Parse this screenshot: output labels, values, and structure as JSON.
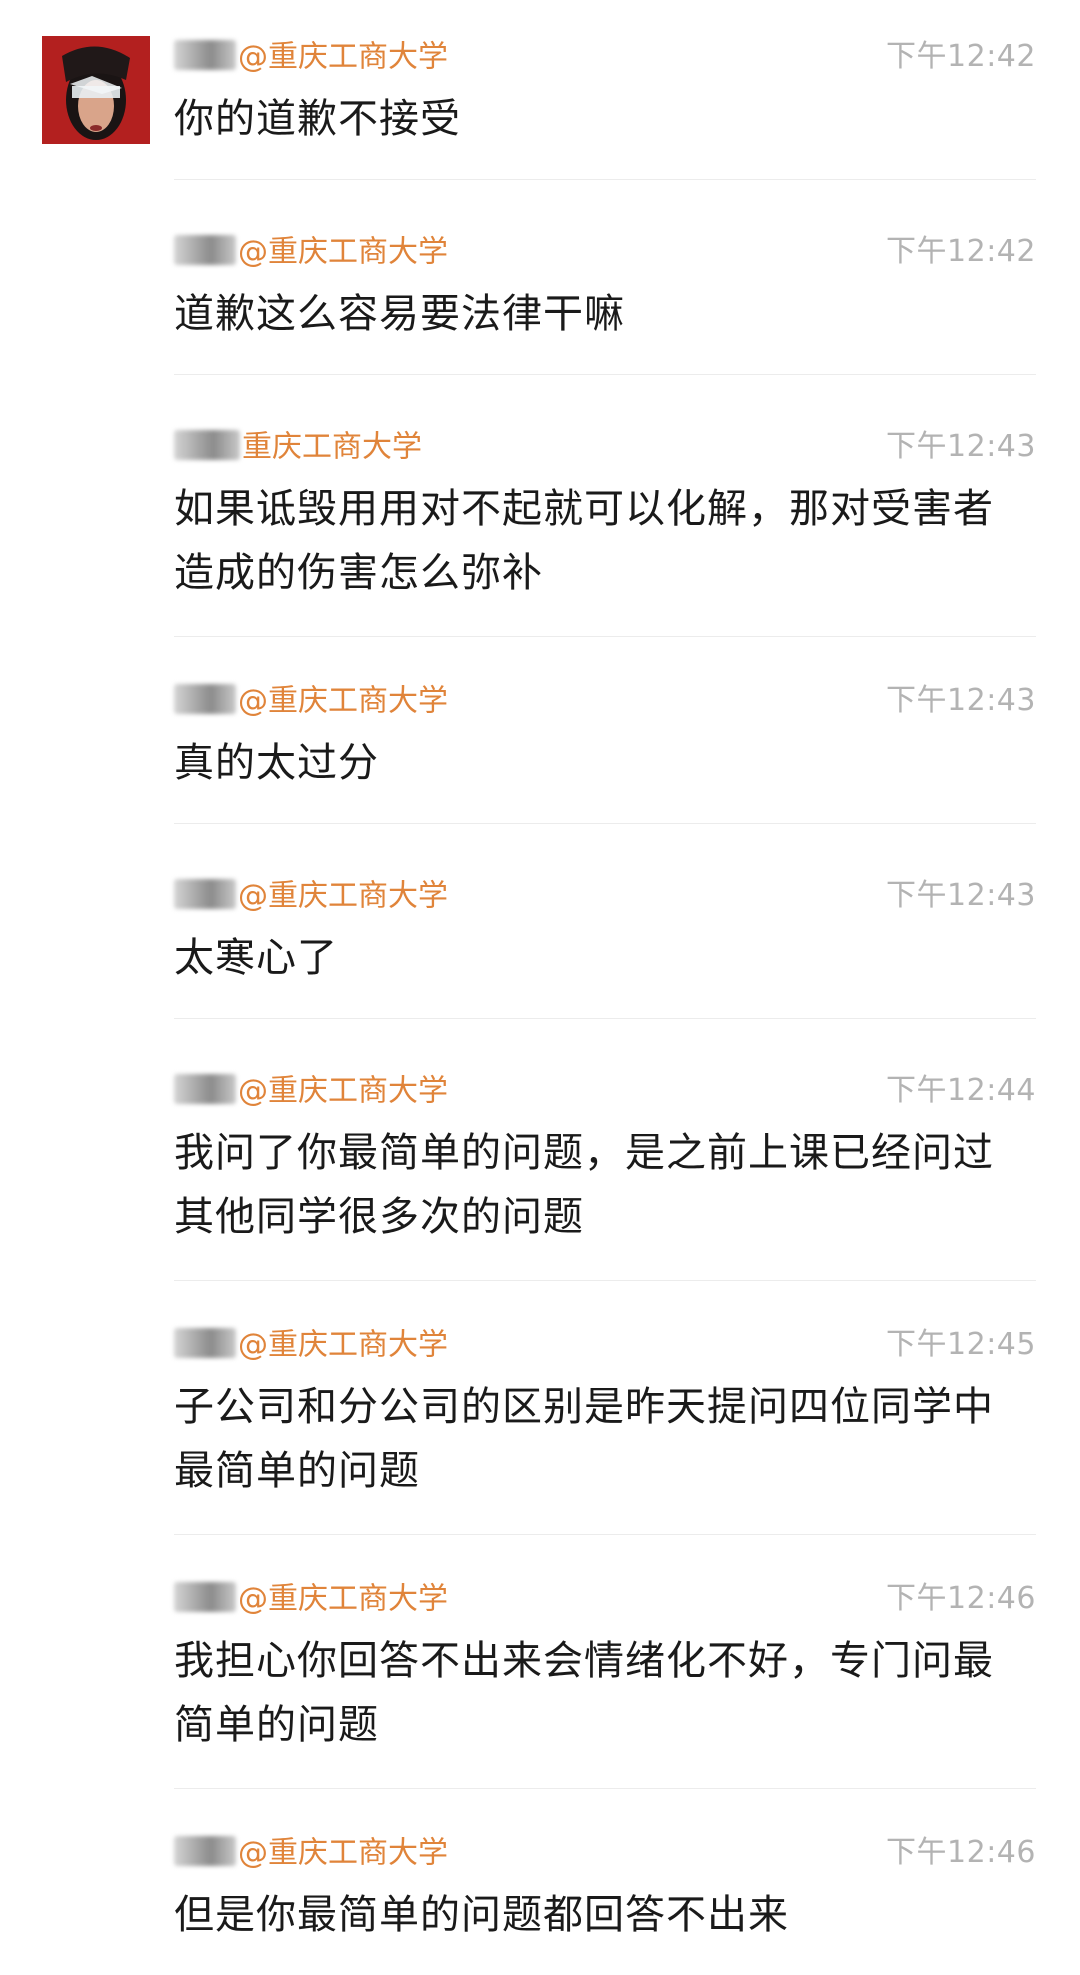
{
  "comments": [
    {
      "school": "@重庆工商大学",
      "time": "下午12:42",
      "text": "你的道歉不接受"
    },
    {
      "school": "@重庆工商大学",
      "time": "下午12:42",
      "text": "道歉这么容易要法律干嘛"
    },
    {
      "school": "重庆工商大学",
      "time": "下午12:43",
      "text": "如果诋毁用用对不起就可以化解，那对受害者造成的伤害怎么弥补"
    },
    {
      "school": "@重庆工商大学",
      "time": "下午12:43",
      "text": "真的太过分"
    },
    {
      "school": "@重庆工商大学",
      "time": "下午12:43",
      "text": "太寒心了"
    },
    {
      "school": "@重庆工商大学",
      "time": "下午12:44",
      "text": "我问了你最简单的问题，是之前上课已经问过其他同学很多次的问题"
    },
    {
      "school": "@重庆工商大学",
      "time": "下午12:45",
      "text": "子公司和分公司的区别是昨天提问四位同学中最简单的问题"
    },
    {
      "school": "@重庆工商大学",
      "time": "下午12:46",
      "text": "我担心你回答不出来会情绪化不好，专门问最简单的问题"
    },
    {
      "school": "@重庆工商大学",
      "time": "下午12:46",
      "text": "但是你最简单的问题都回答不出来"
    }
  ],
  "colors": {
    "school": "#e0843a",
    "time": "#b3b3b3",
    "text": "#1a1a1a",
    "divider": "#ececec"
  },
  "icons": {
    "avatar": "user-avatar-portrait"
  }
}
